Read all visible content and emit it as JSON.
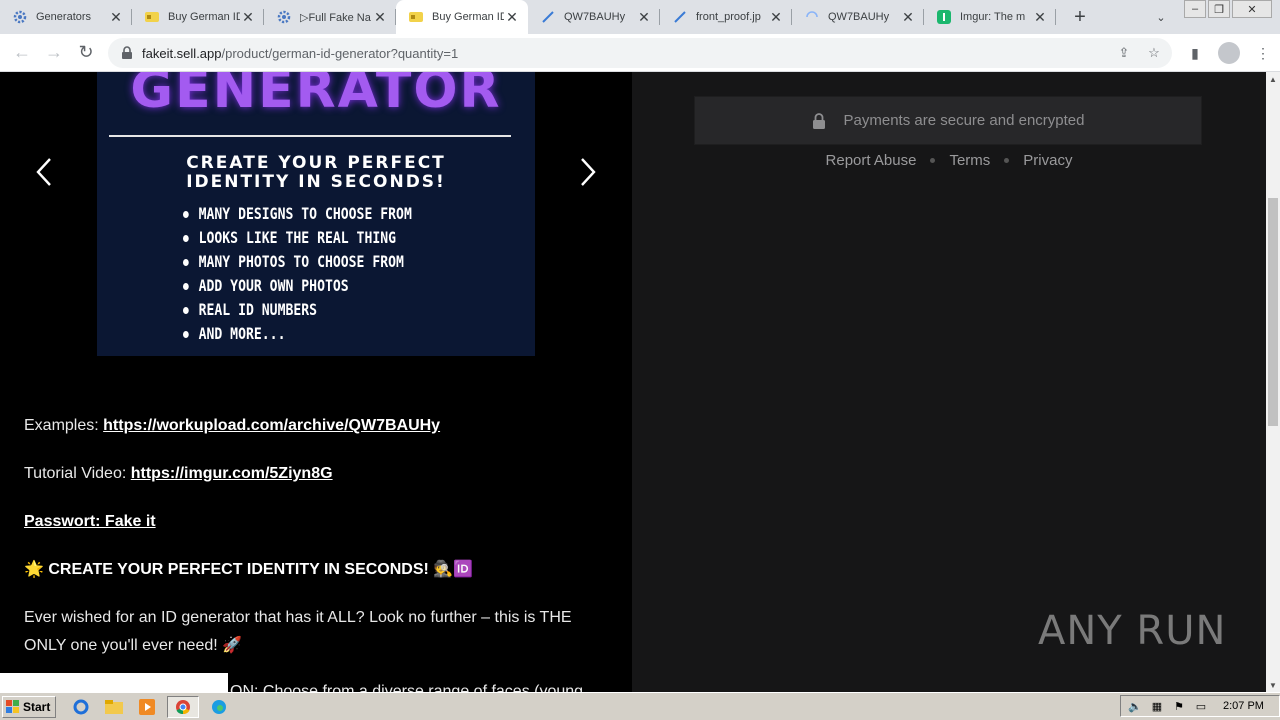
{
  "browser": {
    "tabs": [
      {
        "title": "Generators",
        "favicon": "gear-icon",
        "active": false
      },
      {
        "title": "Buy German ID",
        "favicon": "id-card-icon",
        "active": false
      },
      {
        "title": "▷Full Fake Na",
        "favicon": "gear-icon",
        "active": false
      },
      {
        "title": "Buy German ID",
        "favicon": "id-card-icon",
        "active": true
      },
      {
        "title": "QW7BAUHy",
        "favicon": "feather-icon",
        "active": false
      },
      {
        "title": "front_proof.jp",
        "favicon": "feather-icon",
        "active": false
      },
      {
        "title": "QW7BAUHy",
        "favicon": "loading-icon",
        "active": false
      },
      {
        "title": "Imgur: The m",
        "favicon": "imgur-icon",
        "active": false
      }
    ],
    "new_tab_symbol": "+",
    "address": {
      "domain": "fakeit.sell.app",
      "path": "/product/german-id-generator?quantity=1"
    }
  },
  "product": {
    "image": {
      "title": "GENERATOR",
      "subtitle_line1": "CREATE YOUR PERFECT",
      "subtitle_line2": "IDENTITY IN SECONDS!",
      "features": [
        "MANY DESIGNS TO CHOOSE FROM",
        "LOOKS LIKE THE REAL THING",
        "MANY PHOTOS TO CHOOSE FROM",
        "ADD YOUR OWN PHOTOS",
        "REAL ID NUMBERS",
        "AND MORE..."
      ]
    },
    "examples_label": "Examples: ",
    "examples_link": "https://workupload.com/archive/QW7BAUHy",
    "tutorial_label": "Tutorial Video: ",
    "tutorial_link": "https://imgur.com/5Ziyn8G",
    "password_text": "Passwort: Fake it",
    "headline_prefix": "🌟 ",
    "headline": "CREATE YOUR PERFECT IDENTITY IN SECONDS!",
    "headline_suffix": " 🕵️🆔",
    "body_text": "Ever wished for an ID generator that has it ALL? Look no further – this is THE ONLY one you'll ever need! 🚀",
    "cut_line": "ON: Choose from a diverse range of faces (young"
  },
  "checkout": {
    "secure_text": "Payments are secure and encrypted",
    "links": [
      "Report Abuse",
      "Terms",
      "Privacy"
    ]
  },
  "watermark": "ANY RUN",
  "taskbar": {
    "start_label": "Start",
    "clock": "2:07 PM"
  }
}
